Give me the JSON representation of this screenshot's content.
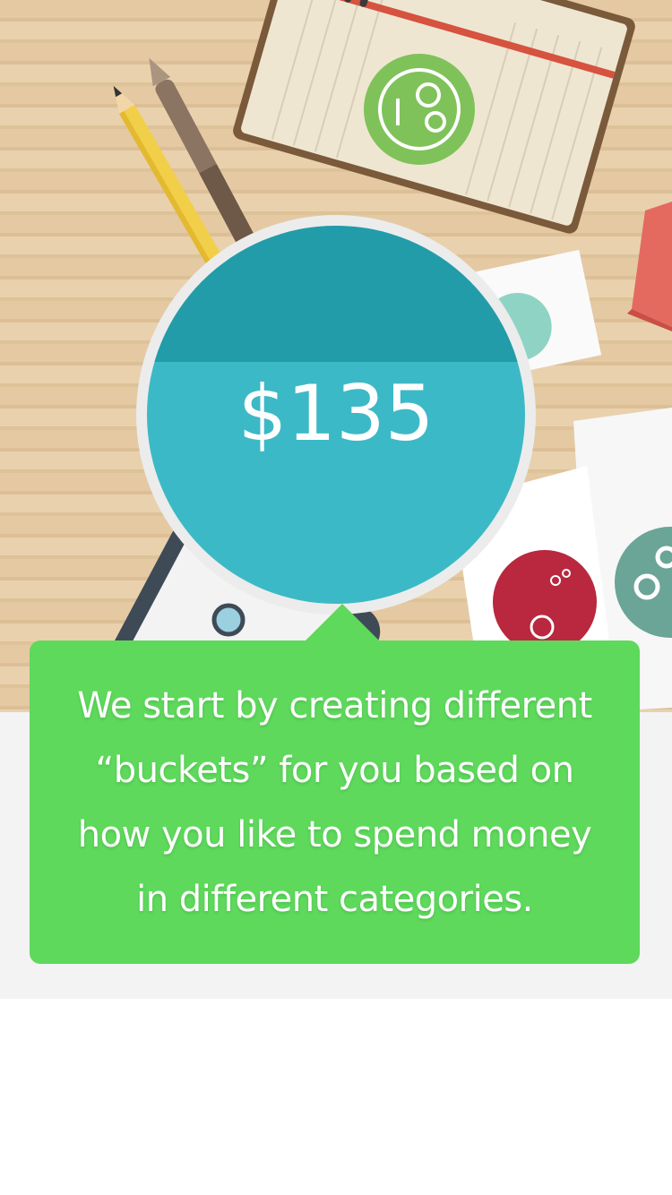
{
  "bucket": {
    "amount": "$135",
    "fill_level": 0.64,
    "colors": {
      "top": "#229ca9",
      "fill": "#3cb9c6",
      "ring": "#ececec"
    }
  },
  "onboarding": {
    "message": "We start by creating different “buckets” for you based on how you like to spend money in different categories.",
    "card_color": "#5ed95c"
  },
  "illustration": {
    "items": [
      "notebook",
      "panda-sticker",
      "pencil",
      "pen",
      "coin-card",
      "eraser",
      "glasses",
      "rupee-badge",
      "scissors-badge",
      "ipad"
    ]
  }
}
